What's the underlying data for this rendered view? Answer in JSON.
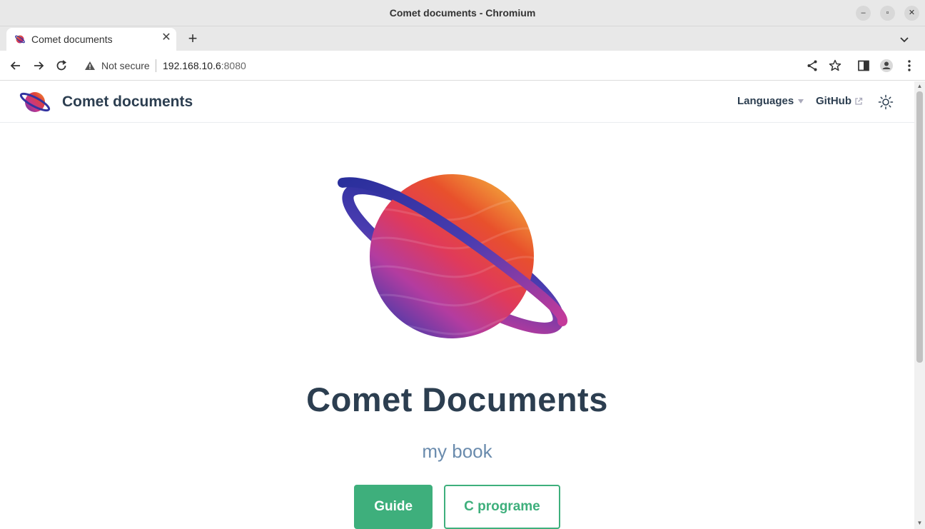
{
  "window": {
    "title": "Comet documents - Chromium",
    "min_glyph": "–",
    "max_glyph": "▫",
    "close_glyph": "✕"
  },
  "tab": {
    "title": "Comet documents",
    "close_glyph": "✕",
    "new_tab_glyph": "+"
  },
  "omnibox": {
    "security_label": "Not secure",
    "host": "192.168.10.6",
    "port": ":8080"
  },
  "site": {
    "title": "Comet documents",
    "nav": {
      "languages": "Languages",
      "github": "GitHub"
    }
  },
  "hero": {
    "title": "Comet Documents",
    "description": "my book",
    "actions": [
      {
        "label": "Guide",
        "style": "primary"
      },
      {
        "label": "C programe",
        "style": "secondary"
      }
    ]
  },
  "colors": {
    "accent": "#3eaf7c",
    "text": "#2c3e50",
    "description": "#6a8bad"
  },
  "icons": {
    "back": "arrow-left",
    "forward": "arrow-right",
    "reload": "reload",
    "warning": "warning-triangle",
    "share": "share",
    "bookmark": "star",
    "side_panel": "side-panel",
    "profile": "profile",
    "menu": "kebab-menu",
    "theme": "sun"
  }
}
